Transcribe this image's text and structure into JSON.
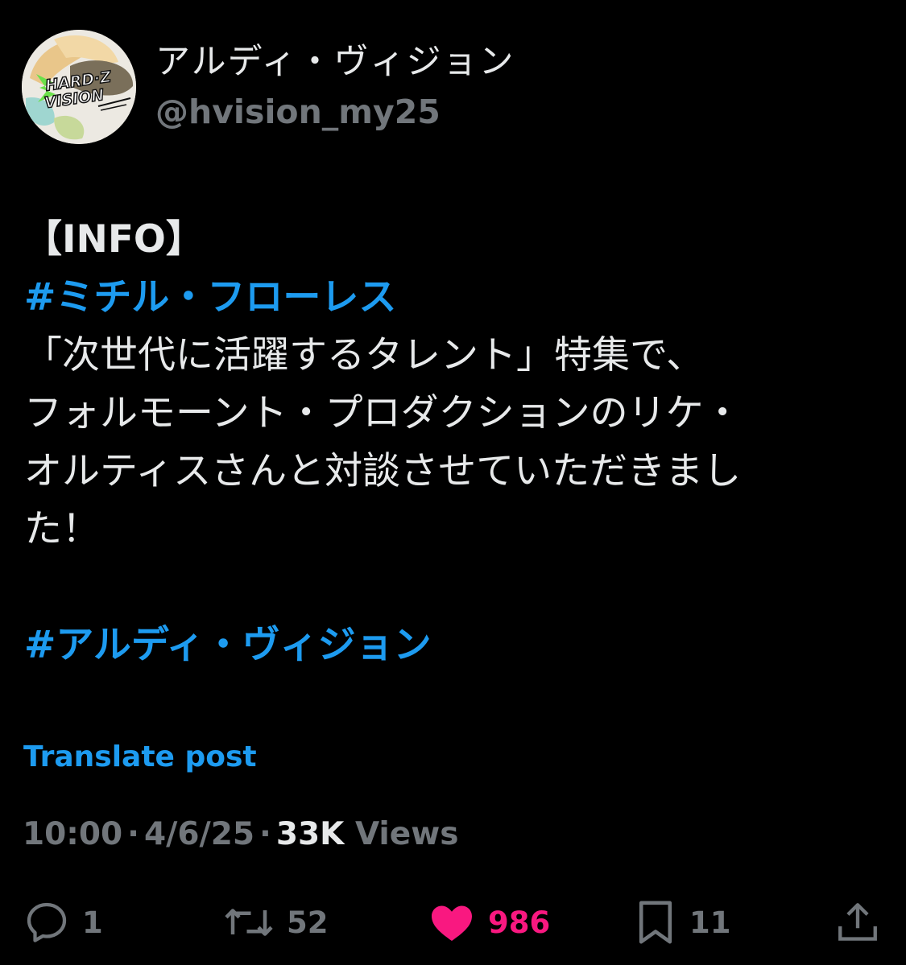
{
  "author": {
    "display_name": "アルディ・ヴィジョン",
    "handle": "@hvision_my25",
    "avatar_text_1": "HARD·Z",
    "avatar_text_2": "VISION"
  },
  "post": {
    "line1": "【INFO】",
    "hashtag1": "#ミチル・フローレス",
    "line3": "「次世代に活躍するタレント」特集で、",
    "line4": "フォルモーント・プロダクションのリケ・",
    "line5": "オルティスさんと対談させていただきまし",
    "line6": "た！",
    "hashtag2": "#アルディ・ヴィジョン"
  },
  "translate_label": "Translate post",
  "meta": {
    "time": "10:00",
    "date": "4/6/25",
    "views_count": "33K",
    "views_label": "Views",
    "separator": "·"
  },
  "actions": {
    "replies": "1",
    "reposts": "52",
    "likes": "986",
    "bookmarks": "11"
  },
  "colors": {
    "accent": "#1d9bf0",
    "like": "#f91880",
    "muted": "#71767b",
    "text": "#e7e9ea",
    "background": "#000000"
  }
}
